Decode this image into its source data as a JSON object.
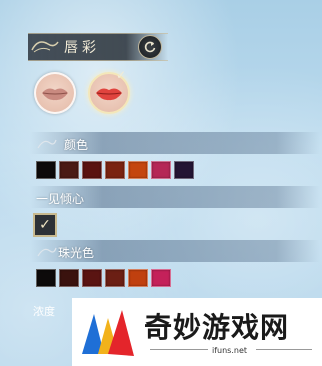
{
  "panel": {
    "title": "唇彩",
    "sections": {
      "color": {
        "label": "颜色",
        "swatches": [
          "#0d0a0a",
          "#4a1a14",
          "#5a1210",
          "#7a2310",
          "#c4460f",
          "#b52757",
          "#231433"
        ]
      },
      "love_at_first_sight": {
        "label": "一见倾心",
        "checked": true,
        "check_glyph": "✓"
      },
      "pearl": {
        "label": "珠光色",
        "swatches": [
          "#0d0a0a",
          "#3a120e",
          "#5a1412",
          "#6b1f14",
          "#c0400f",
          "#c4215a"
        ]
      },
      "opacity": {
        "label": "浓度"
      }
    },
    "selected_mark": "✓"
  },
  "watermark": {
    "name": "奇妙游戏网",
    "url": "ifuns.net"
  }
}
